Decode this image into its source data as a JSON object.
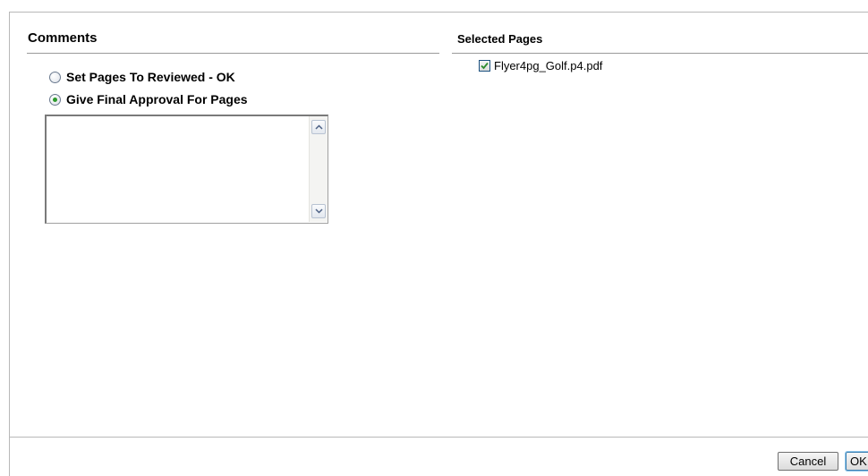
{
  "comments": {
    "title": "Comments",
    "options": [
      {
        "label": "Set Pages To Reviewed - OK",
        "checked": false
      },
      {
        "label": "Give Final Approval For Pages",
        "checked": true
      }
    ],
    "textarea_value": ""
  },
  "selected_pages": {
    "title": "Selected Pages",
    "files": [
      {
        "name": "Flyer4pg_Golf.p4.pdf",
        "checked": true
      }
    ]
  },
  "buttons": {
    "cancel": "Cancel",
    "ok": "OK"
  },
  "colors": {
    "radio_dot": "#2d9a2d",
    "checkmark": "#2e8b2e"
  }
}
